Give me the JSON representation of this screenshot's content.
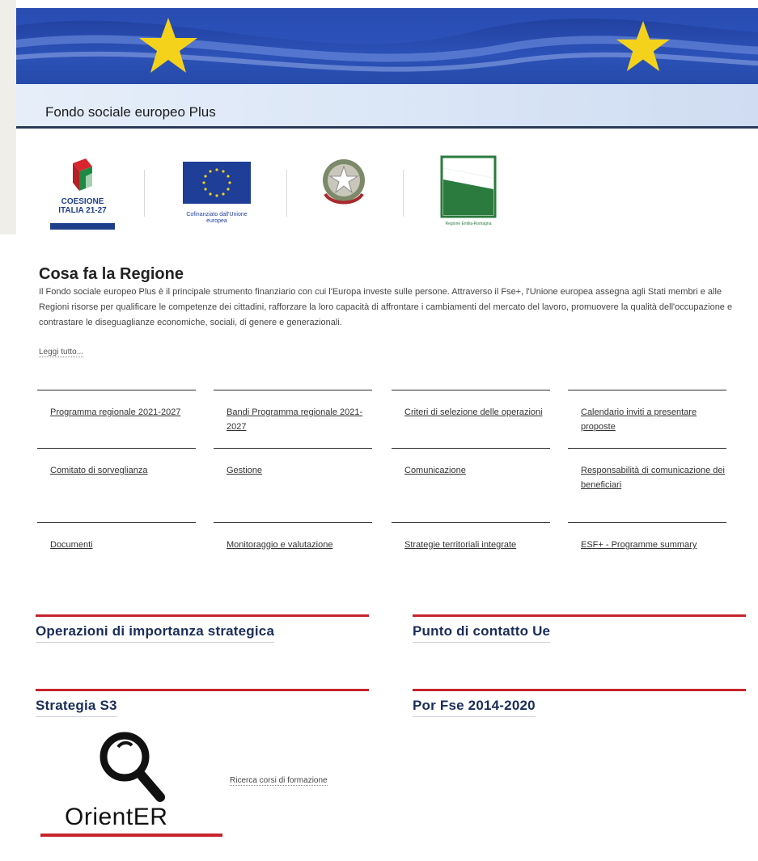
{
  "hero": {
    "title": "Fondo sociale europeo Plus"
  },
  "logos": {
    "coesione": {
      "line1": "COESIONE",
      "line2": "ITALIA 21-27"
    },
    "eu": {
      "caption": "Cofinanziato dall'Unione europea"
    },
    "er": {
      "caption": "Regione Emilia-Romagna"
    }
  },
  "intro": {
    "title": "Cosa fa la Regione",
    "text": "Il Fondo sociale europeo Plus è il principale strumento finanziario con cui l'Europa investe sulle persone. Attraverso il Fse+, l'Unione europea assegna agli Stati membri e alle Regioni risorse per qualificare le competenze dei cittadini, rafforzare la loro capacità di affrontare i cambiamenti del mercato del lavoro, promuovere la qualità dell'occupazione e contrastare le diseguaglianze economiche, sociali, di genere e generazionali.",
    "read_more": "Leggi tutto..."
  },
  "grid": [
    "Programma regionale 2021-2027",
    "Bandi Programma regionale 2021-2027",
    "Criteri di selezione delle operazioni",
    "Calendario inviti a presentare proposte",
    "Comitato di sorveglianza",
    "Gestione",
    "Comunicazione",
    "Responsabilità di comunicazione dei beneficiari",
    "Documenti",
    "Monitoraggio e valutazione",
    "Strategie territoriali integrate",
    "ESF+ - Programme summary"
  ],
  "features": [
    "Operazioni di importanza strategica",
    "Punto di contatto Ue",
    "Strategia S3",
    "Por Fse 2014-2020"
  ],
  "orienter": {
    "word": "OrientER",
    "link": "Ricerca corsi di formazione"
  },
  "colors": {
    "accent_red": "#c8232c",
    "link_navy": "#1a2d5a",
    "eu_blue": "#1e3e97",
    "er_green": "#2a7b3d"
  }
}
